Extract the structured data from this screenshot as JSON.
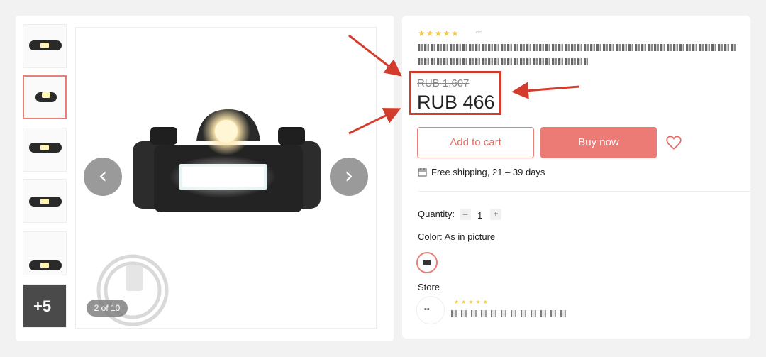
{
  "gallery": {
    "counter": "2 of 10",
    "more_label": "+5",
    "prev_icon": "chevron-left-icon",
    "next_icon": "chevron-right-icon"
  },
  "product": {
    "old_price": "RUB 1,607",
    "price": "RUB 466"
  },
  "actions": {
    "add_to_cart": "Add to cart",
    "buy_now": "Buy now",
    "wishlist_icon": "heart-icon"
  },
  "shipping": {
    "text": "Free shipping, 21 – 39 days"
  },
  "options": {
    "quantity_label": "Quantity:",
    "quantity_value": "1",
    "minus": "–",
    "plus": "+",
    "color_label": "Color:",
    "color_value": "As in picture"
  },
  "store": {
    "label": "Store"
  },
  "colors": {
    "accent": "#ec7b76",
    "annotation": "#d33b2c"
  }
}
